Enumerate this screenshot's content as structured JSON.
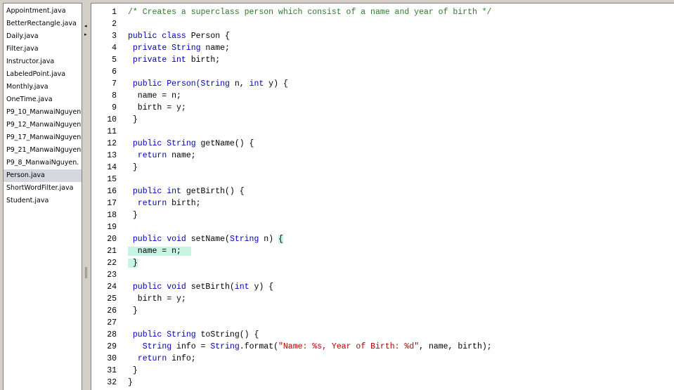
{
  "file_list": {
    "items": [
      "Appointment.java",
      "BetterRectangle.java",
      "Daily.java",
      "Filter.java",
      "Instructor.java",
      "LabeledPoint.java",
      "Monthly.java",
      "OneTime.java",
      "P9_10_ManwaiNguyen",
      "P9_12_ManwaiNguyen",
      "P9_17_ManwaiNguyen",
      "P9_21_ManwaiNguyen",
      "P9_8_ManwaiNguyen.",
      "Person.java",
      "ShortWordFilter.java",
      "Student.java"
    ],
    "selected": "Person.java"
  },
  "splitter": {
    "collapse_left": "◂",
    "expand_right": "▸"
  },
  "editor": {
    "colors": {
      "keyword": "#0000c0",
      "comment": "#2c7a2c",
      "string": "#b00000",
      "highlight": "#c8f5e3"
    },
    "lines": [
      {
        "n": "1",
        "tokens": [
          {
            "t": "/* Creates a superclass person which consist of a name and year of birth */",
            "c": "cm"
          }
        ]
      },
      {
        "n": "2",
        "tokens": []
      },
      {
        "n": "3",
        "tokens": [
          {
            "t": "public class",
            "c": "kw"
          },
          {
            "t": " Person {"
          }
        ]
      },
      {
        "n": "4",
        "tokens": [
          {
            "t": " "
          },
          {
            "t": "private String",
            "c": "kw"
          },
          {
            "t": " name;"
          }
        ]
      },
      {
        "n": "5",
        "tokens": [
          {
            "t": " "
          },
          {
            "t": "private int",
            "c": "kw"
          },
          {
            "t": " birth;"
          }
        ]
      },
      {
        "n": "6",
        "tokens": []
      },
      {
        "n": "7",
        "tokens": [
          {
            "t": " "
          },
          {
            "t": "public",
            "c": "kw"
          },
          {
            "t": " "
          },
          {
            "t": "Person(String",
            "c": "kw"
          },
          {
            "t": " n, "
          },
          {
            "t": "int",
            "c": "kw"
          },
          {
            "t": " y) {"
          }
        ]
      },
      {
        "n": "8",
        "tokens": [
          {
            "t": "  name = n;"
          }
        ]
      },
      {
        "n": "9",
        "tokens": [
          {
            "t": "  birth = y;"
          }
        ]
      },
      {
        "n": "10",
        "tokens": [
          {
            "t": " }"
          }
        ]
      },
      {
        "n": "11",
        "tokens": []
      },
      {
        "n": "12",
        "tokens": [
          {
            "t": " "
          },
          {
            "t": "public String",
            "c": "kw"
          },
          {
            "t": " getName() {"
          }
        ]
      },
      {
        "n": "13",
        "tokens": [
          {
            "t": "  "
          },
          {
            "t": "return",
            "c": "kw"
          },
          {
            "t": " name;"
          }
        ]
      },
      {
        "n": "14",
        "tokens": [
          {
            "t": " }"
          }
        ]
      },
      {
        "n": "15",
        "tokens": []
      },
      {
        "n": "16",
        "tokens": [
          {
            "t": " "
          },
          {
            "t": "public int",
            "c": "kw"
          },
          {
            "t": " getBirth() {"
          }
        ]
      },
      {
        "n": "17",
        "tokens": [
          {
            "t": "  "
          },
          {
            "t": "return",
            "c": "kw"
          },
          {
            "t": " birth;"
          }
        ]
      },
      {
        "n": "18",
        "tokens": [
          {
            "t": " }"
          }
        ]
      },
      {
        "n": "19",
        "tokens": []
      },
      {
        "n": "20",
        "tokens": [
          {
            "t": " "
          },
          {
            "t": "public void",
            "c": "kw"
          },
          {
            "t": " setName("
          },
          {
            "t": "String",
            "c": "kw"
          },
          {
            "t": " n) "
          },
          {
            "t": "{",
            "c": "hl"
          }
        ]
      },
      {
        "n": "21",
        "tokens": [
          {
            "t": "  name = n;  ",
            "c": "hl"
          }
        ]
      },
      {
        "n": "22",
        "tokens": [
          {
            "t": " }",
            "c": "hl"
          }
        ]
      },
      {
        "n": "23",
        "tokens": []
      },
      {
        "n": "24",
        "tokens": [
          {
            "t": " "
          },
          {
            "t": "public void",
            "c": "kw"
          },
          {
            "t": " setBirth("
          },
          {
            "t": "int",
            "c": "kw"
          },
          {
            "t": " y) {"
          }
        ]
      },
      {
        "n": "25",
        "tokens": [
          {
            "t": "  birth = y;"
          }
        ]
      },
      {
        "n": "26",
        "tokens": [
          {
            "t": " }"
          }
        ]
      },
      {
        "n": "27",
        "tokens": []
      },
      {
        "n": "28",
        "tokens": [
          {
            "t": " "
          },
          {
            "t": "public String",
            "c": "kw"
          },
          {
            "t": " toString() {"
          }
        ]
      },
      {
        "n": "29",
        "tokens": [
          {
            "t": "   "
          },
          {
            "t": "String",
            "c": "kw"
          },
          {
            "t": " info = "
          },
          {
            "t": "String",
            "c": "kw"
          },
          {
            "t": ".format("
          },
          {
            "t": "\"Name: %s, Year of Birth: %d\"",
            "c": "st"
          },
          {
            "t": ", name, birth);"
          }
        ]
      },
      {
        "n": "30",
        "tokens": [
          {
            "t": "  "
          },
          {
            "t": "return",
            "c": "kw"
          },
          {
            "t": " info;"
          }
        ]
      },
      {
        "n": "31",
        "tokens": [
          {
            "t": " }"
          }
        ]
      },
      {
        "n": "32",
        "tokens": [
          {
            "t": "}"
          }
        ]
      }
    ]
  }
}
